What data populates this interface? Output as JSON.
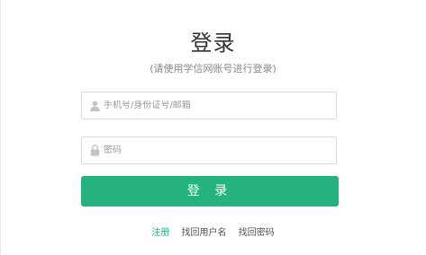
{
  "login": {
    "title": "登录",
    "subtitle": "(请使用学信网账号进行登录)",
    "username": {
      "placeholder": "手机号/身份证号/邮箱",
      "value": "",
      "icon": "user-icon"
    },
    "password": {
      "placeholder": "密码",
      "value": "",
      "icon": "lock-icon"
    },
    "button_label": "登 录"
  },
  "links": {
    "register": "注册",
    "find_username": "找回用户名",
    "find_password": "找回密码"
  },
  "colors": {
    "accent": "#24b37e",
    "border": "#dcdcdc",
    "text": "#333333",
    "muted": "#999999"
  }
}
